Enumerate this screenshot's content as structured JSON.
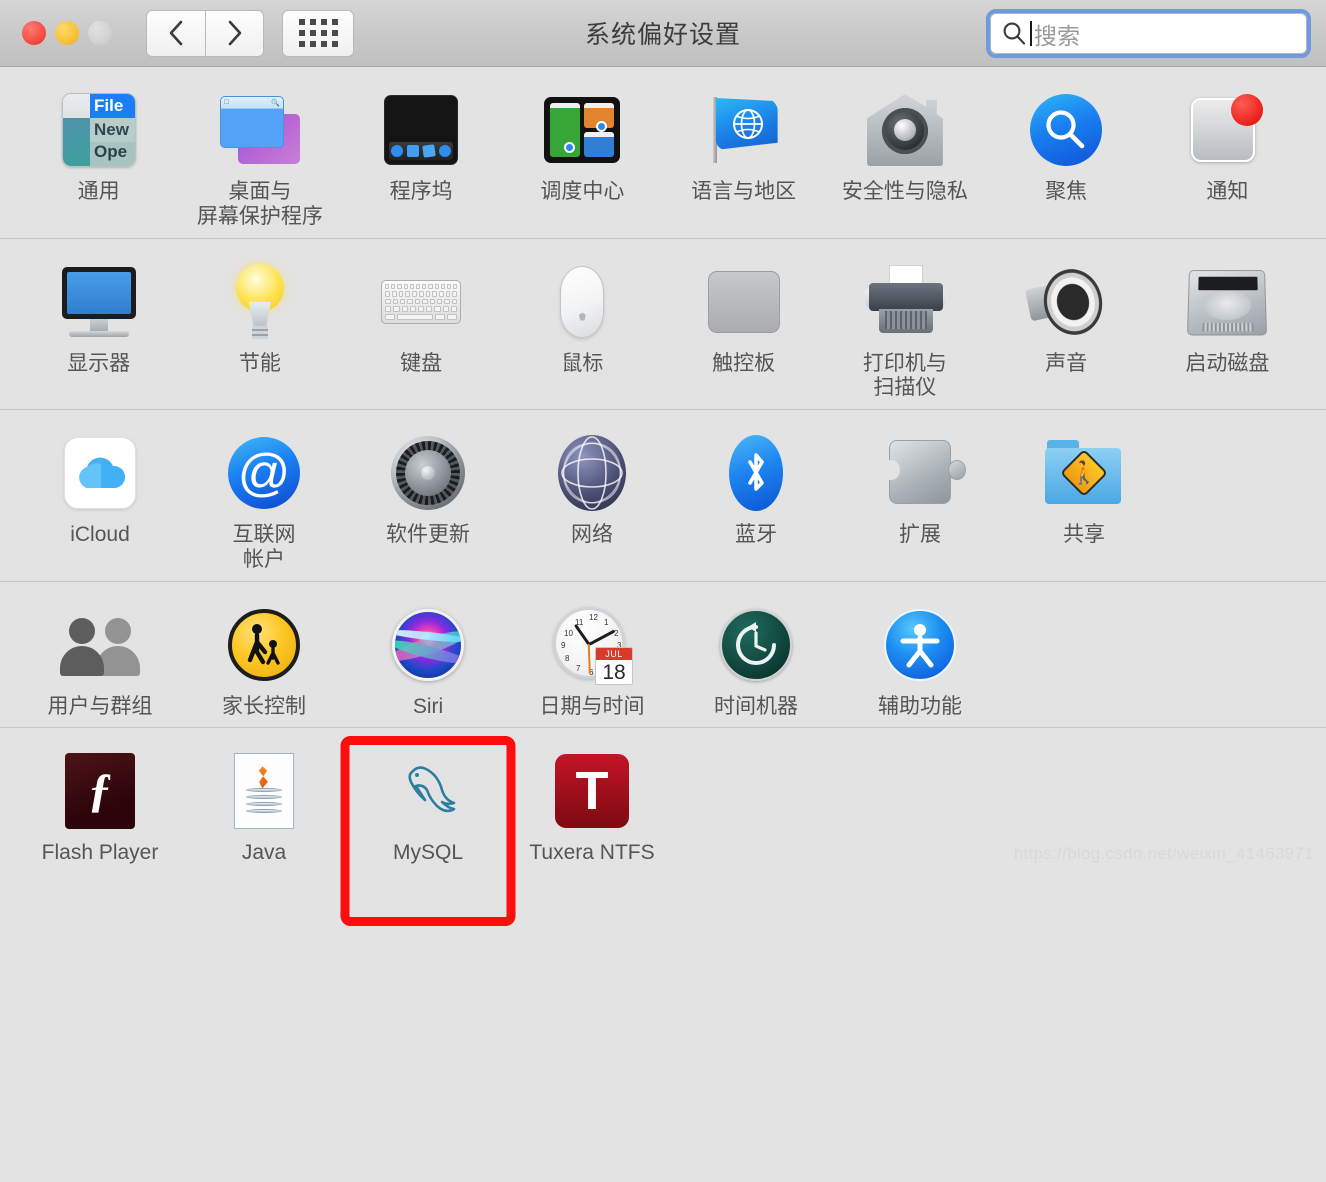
{
  "window": {
    "title": "系统偏好设置",
    "traffic_lights": [
      "close-button",
      "minimize-button",
      "zoom-button"
    ],
    "nav_back_label": "‹",
    "nav_forward_label": "›",
    "grid_button_name": "show-all-button"
  },
  "search": {
    "placeholder": "搜索",
    "value": "",
    "focus_color": "#6e9ae0"
  },
  "sections": [
    {
      "id": "personal",
      "panes": [
        {
          "name": "general",
          "label": "通用",
          "label2": "",
          "icon": "general-icon",
          "icon_text": {
            "file": "File",
            "new": "New",
            "open": "Ope"
          }
        },
        {
          "name": "desktop-screensaver",
          "label": "桌面与",
          "label2": "屏幕保护程序",
          "icon": "desktop-screensaver-icon"
        },
        {
          "name": "dock",
          "label": "程序坞",
          "label2": "",
          "icon": "dock-icon"
        },
        {
          "name": "mission-control",
          "label": "调度中心",
          "label2": "",
          "icon": "mission-control-icon"
        },
        {
          "name": "language-region",
          "label": "语言与地区",
          "label2": "",
          "icon": "language-flag-icon"
        },
        {
          "name": "security-privacy",
          "label": "安全性与隐私",
          "label2": "",
          "icon": "security-house-icon"
        },
        {
          "name": "spotlight",
          "label": "聚焦",
          "label2": "",
          "icon": "spotlight-magnifier-icon"
        },
        {
          "name": "notifications",
          "label": "通知",
          "label2": "",
          "icon": "notifications-icon",
          "badge": true
        }
      ]
    },
    {
      "id": "hardware",
      "panes": [
        {
          "name": "displays",
          "label": "显示器",
          "label2": "",
          "icon": "display-monitor-icon"
        },
        {
          "name": "energy-saver",
          "label": "节能",
          "label2": "",
          "icon": "lightbulb-icon"
        },
        {
          "name": "keyboard",
          "label": "键盘",
          "label2": "",
          "icon": "keyboard-icon"
        },
        {
          "name": "mouse",
          "label": "鼠标",
          "label2": "",
          "icon": "mouse-icon"
        },
        {
          "name": "trackpad",
          "label": "触控板",
          "label2": "",
          "icon": "trackpad-icon"
        },
        {
          "name": "printers-scanners",
          "label": "打印机与",
          "label2": "扫描仪",
          "icon": "printer-icon"
        },
        {
          "name": "sound",
          "label": "声音",
          "label2": "",
          "icon": "speaker-icon"
        },
        {
          "name": "startup-disk",
          "label": "启动磁盘",
          "label2": "",
          "icon": "hard-disk-icon"
        }
      ]
    },
    {
      "id": "internet-wireless",
      "panes": [
        {
          "name": "icloud",
          "label": "iCloud",
          "label2": "",
          "icon": "icloud-cloud-icon"
        },
        {
          "name": "internet-accounts",
          "label": "互联网",
          "label2": "帐户",
          "icon": "at-sign-icon",
          "icon_text": {
            "at": "@"
          }
        },
        {
          "name": "software-update",
          "label": "软件更新",
          "label2": "",
          "icon": "gear-icon"
        },
        {
          "name": "network",
          "label": "网络",
          "label2": "",
          "icon": "globe-icon"
        },
        {
          "name": "bluetooth",
          "label": "蓝牙",
          "label2": "",
          "icon": "bluetooth-icon"
        },
        {
          "name": "extensions",
          "label": "扩展",
          "label2": "",
          "icon": "puzzle-piece-icon"
        },
        {
          "name": "sharing",
          "label": "共享",
          "label2": "",
          "icon": "sharing-folder-icon"
        }
      ]
    },
    {
      "id": "system",
      "panes": [
        {
          "name": "users-groups",
          "label": "用户与群组",
          "label2": "",
          "icon": "users-silhouette-icon"
        },
        {
          "name": "parental-controls",
          "label": "家长控制",
          "label2": "",
          "icon": "parental-controls-icon"
        },
        {
          "name": "siri",
          "label": "Siri",
          "label2": "",
          "icon": "siri-orb-icon"
        },
        {
          "name": "date-time",
          "label": "日期与时间",
          "label2": "",
          "icon": "clock-calendar-icon",
          "icon_text": {
            "month": "JUL",
            "day": "18"
          }
        },
        {
          "name": "time-machine",
          "label": "时间机器",
          "label2": "",
          "icon": "time-machine-icon"
        },
        {
          "name": "accessibility",
          "label": "辅助功能",
          "label2": "",
          "icon": "accessibility-icon"
        }
      ]
    },
    {
      "id": "third-party",
      "panes": [
        {
          "name": "flash-player",
          "label": "Flash Player",
          "label2": "",
          "icon": "flash-player-icon",
          "icon_text": {
            "f": "ƒ"
          }
        },
        {
          "name": "java",
          "label": "Java",
          "label2": "",
          "icon": "java-coffee-icon"
        },
        {
          "name": "mysql",
          "label": "MySQL",
          "label2": "",
          "icon": "mysql-dolphin-icon",
          "highlighted": true
        },
        {
          "name": "tuxera-ntfs",
          "label": "Tuxera NTFS",
          "label2": "",
          "icon": "tuxera-t-icon",
          "icon_text": {
            "t": "T"
          }
        }
      ]
    }
  ],
  "annotation": {
    "highlight_color": "#fd0d0d",
    "target": "mysql"
  },
  "watermark": "https://blog.csdn.net/weixin_41463971"
}
